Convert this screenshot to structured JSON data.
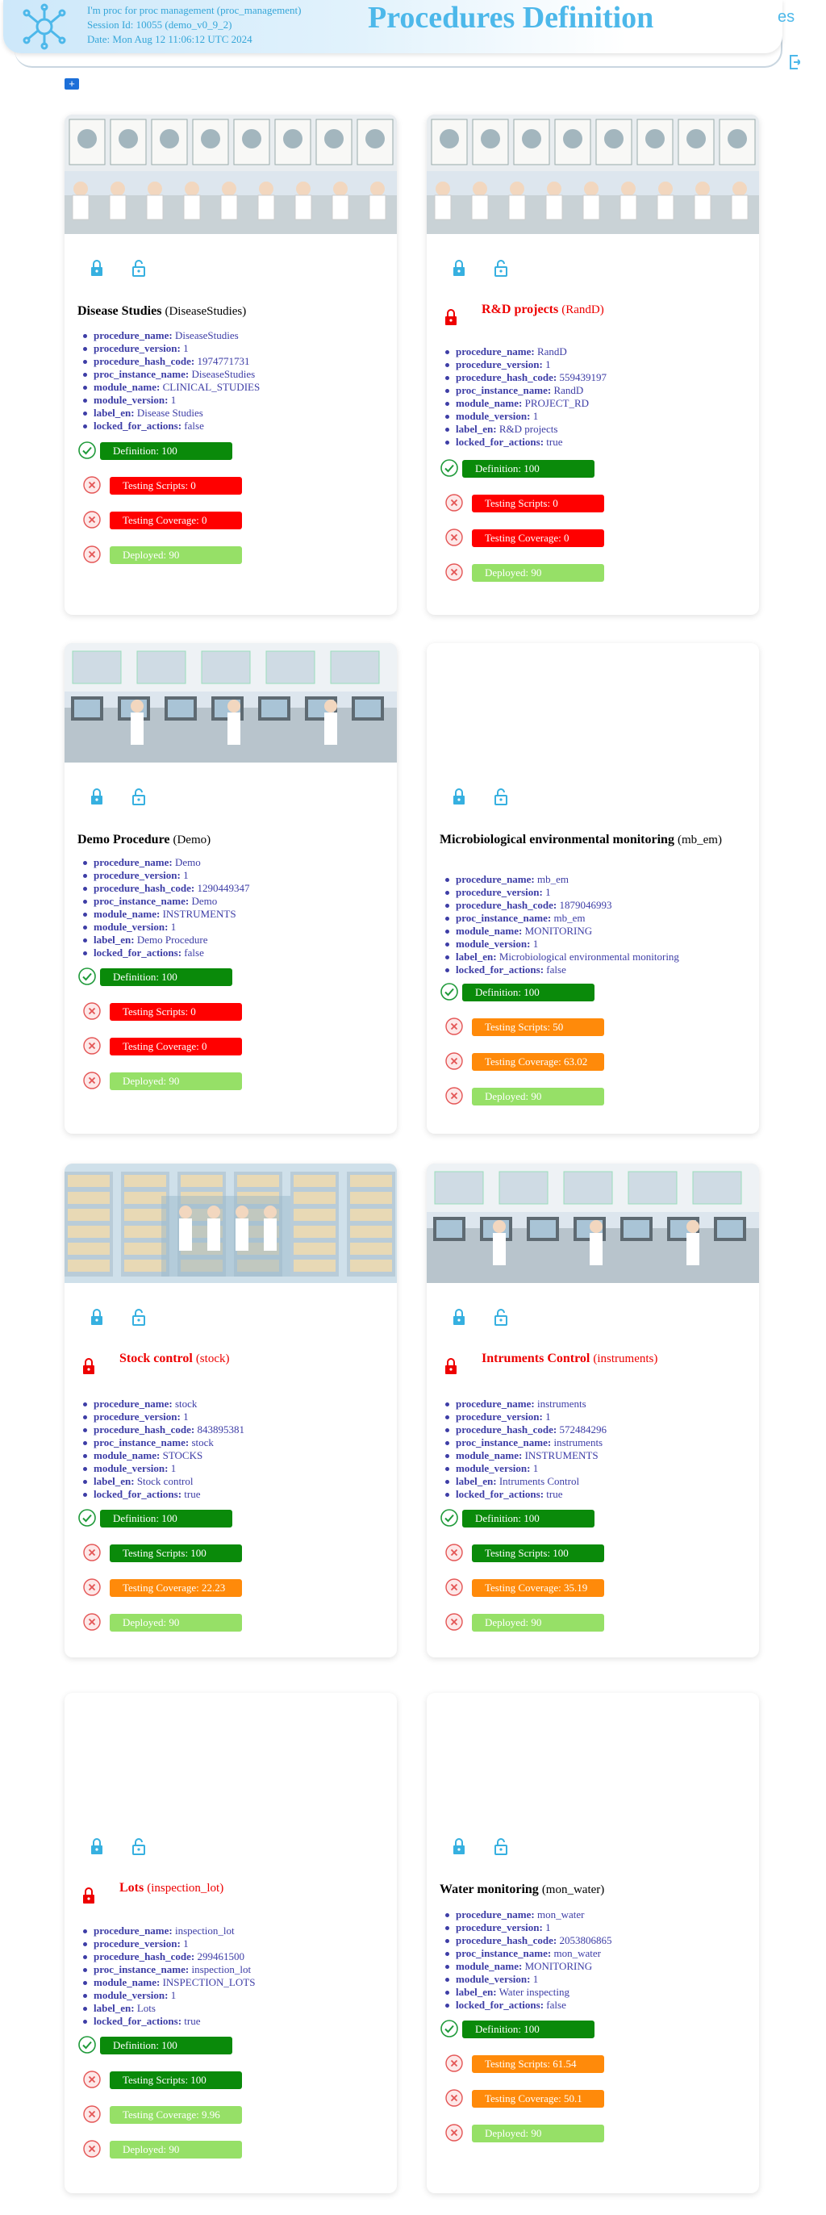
{
  "header": {
    "session_lines": [
      "I'm proc for proc management (proc_management)",
      "Session Id: 10055 (demo_v0_9_2)",
      "Date: Mon Aug 12 11:06:12 UTC 2024"
    ],
    "title": "Procedures Definition",
    "language": "es",
    "add_button": "+"
  },
  "colors": {
    "accent": "#4db8ea",
    "ok": "#0a8a0a",
    "fail": "#ff0000",
    "warn": "#ff8a0a",
    "deployed": "#96e067"
  },
  "cards": [
    {
      "name": "Disease Studies",
      "code": "(DiseaseStudies)",
      "locked": false,
      "image": "lab-research-illustration",
      "props": [
        [
          "procedure_name:",
          "DiseaseStudies"
        ],
        [
          "procedure_version:",
          "1"
        ],
        [
          "procedure_hash_code:",
          "1974771731"
        ],
        [
          "proc_instance_name:",
          "DiseaseStudies"
        ],
        [
          "module_name:",
          "CLINICAL_STUDIES"
        ],
        [
          "module_version:",
          "1"
        ],
        [
          "label_en:",
          "Disease Studies"
        ],
        [
          "locked_for_actions:",
          "false"
        ]
      ],
      "status": [
        [
          "Definition: 100",
          "green",
          "ok"
        ],
        [
          "Testing Scripts: 0",
          "red",
          "fail"
        ],
        [
          "Testing Coverage: 0",
          "red",
          "fail"
        ],
        [
          "Deployed: 90",
          "lightgreen",
          "fail"
        ]
      ]
    },
    {
      "name": "R&D projects",
      "code": "(RandD)",
      "locked": true,
      "image": "lab-research-illustration",
      "props": [
        [
          "procedure_name:",
          "RandD"
        ],
        [
          "procedure_version:",
          "1"
        ],
        [
          "procedure_hash_code:",
          "559439197"
        ],
        [
          "proc_instance_name:",
          "RandD"
        ],
        [
          "module_name:",
          "PROJECT_RD"
        ],
        [
          "module_version:",
          "1"
        ],
        [
          "label_en:",
          "R&D projects"
        ],
        [
          "locked_for_actions:",
          "true"
        ]
      ],
      "status": [
        [
          "Definition: 100",
          "green",
          "ok"
        ],
        [
          "Testing Scripts: 0",
          "red",
          "fail"
        ],
        [
          "Testing Coverage: 0",
          "red",
          "fail"
        ],
        [
          "Deployed: 90",
          "lightgreen",
          "fail"
        ]
      ]
    },
    {
      "name": "Demo Procedure",
      "code": "(Demo)",
      "locked": false,
      "image": "lab-instruments-photo",
      "props": [
        [
          "procedure_name:",
          "Demo"
        ],
        [
          "procedure_version:",
          "1"
        ],
        [
          "procedure_hash_code:",
          "1290449347"
        ],
        [
          "proc_instance_name:",
          "Demo"
        ],
        [
          "module_name:",
          "INSTRUMENTS"
        ],
        [
          "module_version:",
          "1"
        ],
        [
          "label_en:",
          "Demo Procedure"
        ],
        [
          "locked_for_actions:",
          "false"
        ]
      ],
      "status": [
        [
          "Definition: 100",
          "green",
          "ok"
        ],
        [
          "Testing Scripts: 0",
          "red",
          "fail"
        ],
        [
          "Testing Coverage: 0",
          "red",
          "fail"
        ],
        [
          "Deployed: 90",
          "lightgreen",
          "fail"
        ]
      ]
    },
    {
      "name": "Microbiological environmental monitoring",
      "code": "(mb_em)",
      "locked": false,
      "image": "",
      "props": [
        [
          "procedure_name:",
          "mb_em"
        ],
        [
          "procedure_version:",
          "1"
        ],
        [
          "procedure_hash_code:",
          "1879046993"
        ],
        [
          "proc_instance_name:",
          "mb_em"
        ],
        [
          "module_name:",
          "MONITORING"
        ],
        [
          "module_version:",
          "1"
        ],
        [
          "label_en:",
          "Microbiological environmental monitoring"
        ],
        [
          "locked_for_actions:",
          "false"
        ]
      ],
      "status": [
        [
          "Definition: 100",
          "green",
          "ok"
        ],
        [
          "Testing Scripts: 50",
          "orange",
          "fail"
        ],
        [
          "Testing Coverage: 63.02",
          "orange",
          "fail"
        ],
        [
          "Deployed: 90",
          "lightgreen",
          "fail"
        ]
      ]
    },
    {
      "name": "Stock control",
      "code": "(stock)",
      "locked": true,
      "image": "lab-stock-photo",
      "props": [
        [
          "procedure_name:",
          "stock"
        ],
        [
          "procedure_version:",
          "1"
        ],
        [
          "procedure_hash_code:",
          "843895381"
        ],
        [
          "proc_instance_name:",
          "stock"
        ],
        [
          "module_name:",
          "STOCKS"
        ],
        [
          "module_version:",
          "1"
        ],
        [
          "label_en:",
          "Stock control"
        ],
        [
          "locked_for_actions:",
          "true"
        ]
      ],
      "status": [
        [
          "Definition: 100",
          "green",
          "ok"
        ],
        [
          "Testing Scripts: 100",
          "green",
          "fail"
        ],
        [
          "Testing Coverage: 22.23",
          "orange",
          "fail"
        ],
        [
          "Deployed: 90",
          "lightgreen",
          "fail"
        ]
      ]
    },
    {
      "name": "Intruments Control",
      "code": "(instruments)",
      "locked": true,
      "image": "lab-instruments-photo",
      "props": [
        [
          "procedure_name:",
          "instruments"
        ],
        [
          "procedure_version:",
          "1"
        ],
        [
          "procedure_hash_code:",
          "572484296"
        ],
        [
          "proc_instance_name:",
          "instruments"
        ],
        [
          "module_name:",
          "INSTRUMENTS"
        ],
        [
          "module_version:",
          "1"
        ],
        [
          "label_en:",
          "Intruments Control"
        ],
        [
          "locked_for_actions:",
          "true"
        ]
      ],
      "status": [
        [
          "Definition: 100",
          "green",
          "ok"
        ],
        [
          "Testing Scripts: 100",
          "green",
          "fail"
        ],
        [
          "Testing Coverage: 35.19",
          "orange",
          "fail"
        ],
        [
          "Deployed: 90",
          "lightgreen",
          "fail"
        ]
      ]
    },
    {
      "name": "Lots",
      "code": "(inspection_lot)",
      "locked": true,
      "image": "",
      "props": [
        [
          "procedure_name:",
          "inspection_lot"
        ],
        [
          "procedure_version:",
          "1"
        ],
        [
          "procedure_hash_code:",
          "299461500"
        ],
        [
          "proc_instance_name:",
          "inspection_lot"
        ],
        [
          "module_name:",
          "INSPECTION_LOTS"
        ],
        [
          "module_version:",
          "1"
        ],
        [
          "label_en:",
          "Lots"
        ],
        [
          "locked_for_actions:",
          "true"
        ]
      ],
      "status": [
        [
          "Definition: 100",
          "green",
          "ok"
        ],
        [
          "Testing Scripts: 100",
          "green",
          "fail"
        ],
        [
          "Testing Coverage: 9.96",
          "lightgreen",
          "fail"
        ],
        [
          "Deployed: 90",
          "lightgreen",
          "fail"
        ]
      ]
    },
    {
      "name": "Water monitoring",
      "code": "(mon_water)",
      "locked": false,
      "image": "",
      "props": [
        [
          "procedure_name:",
          "mon_water"
        ],
        [
          "procedure_version:",
          "1"
        ],
        [
          "procedure_hash_code:",
          "2053806865"
        ],
        [
          "proc_instance_name:",
          "mon_water"
        ],
        [
          "module_name:",
          "MONITORING"
        ],
        [
          "module_version:",
          "1"
        ],
        [
          "label_en:",
          "Water inspecting"
        ],
        [
          "locked_for_actions:",
          "false"
        ]
      ],
      "status": [
        [
          "Definition: 100",
          "green",
          "ok"
        ],
        [
          "Testing Scripts: 61.54",
          "orange",
          "fail"
        ],
        [
          "Testing Coverage: 50.1",
          "orange",
          "fail"
        ],
        [
          "Deployed: 90",
          "lightgreen",
          "fail"
        ]
      ]
    }
  ]
}
